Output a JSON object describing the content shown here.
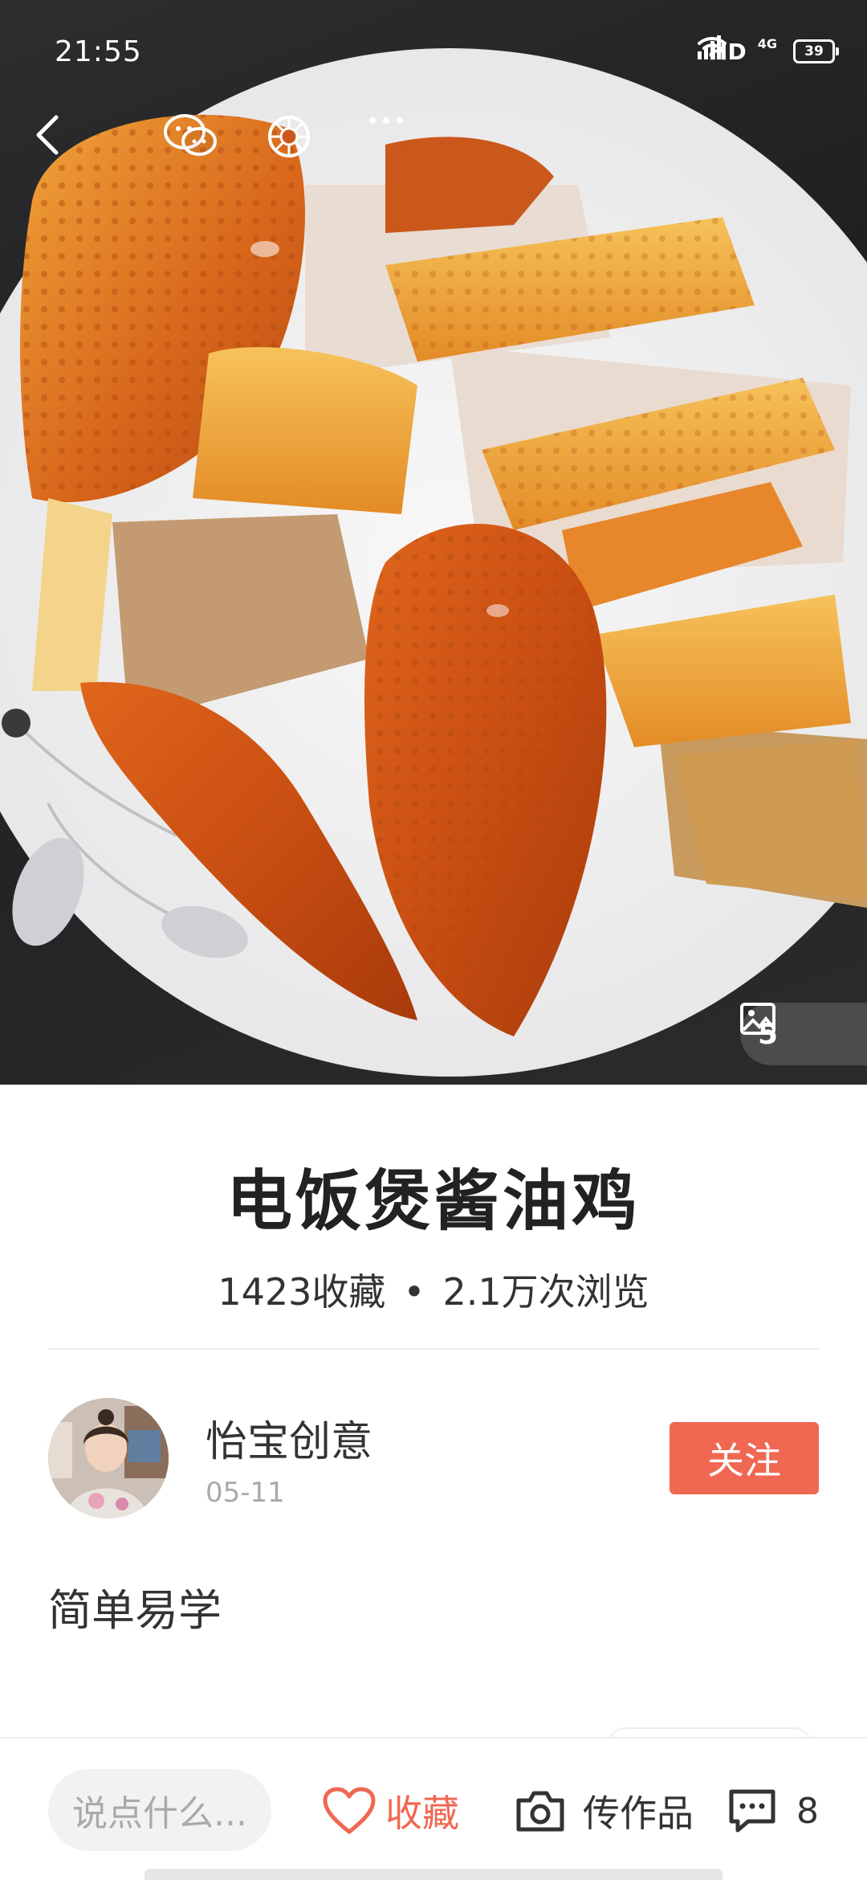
{
  "status_bar": {
    "time": "21:55",
    "network_label": "HD",
    "network_type": "4G",
    "battery": "39",
    "icons": [
      "wifi-icon",
      "signal-icon",
      "battery-icon"
    ]
  },
  "nav": {
    "icons": [
      "back-icon",
      "wechat-icon",
      "moments-icon",
      "more-icon"
    ]
  },
  "gallery": {
    "photo_count": "5",
    "icon": "image-icon"
  },
  "recipe": {
    "title": "电饭煲酱油鸡",
    "favorites": "1423收藏",
    "separator": "•",
    "views": "2.1万次浏览",
    "description": "简单易学"
  },
  "author": {
    "name": "怡宝创意",
    "date": "05-11",
    "follow_label": "关注"
  },
  "bottom_bar": {
    "comment_placeholder": "说点什么...",
    "favorite_label": "收藏",
    "upload_label": "传作品",
    "comment_count": "8"
  },
  "colors": {
    "accent": "#f06752",
    "text_primary": "#222222",
    "text_secondary": "#a9a9a9",
    "divider": "#ececec"
  }
}
